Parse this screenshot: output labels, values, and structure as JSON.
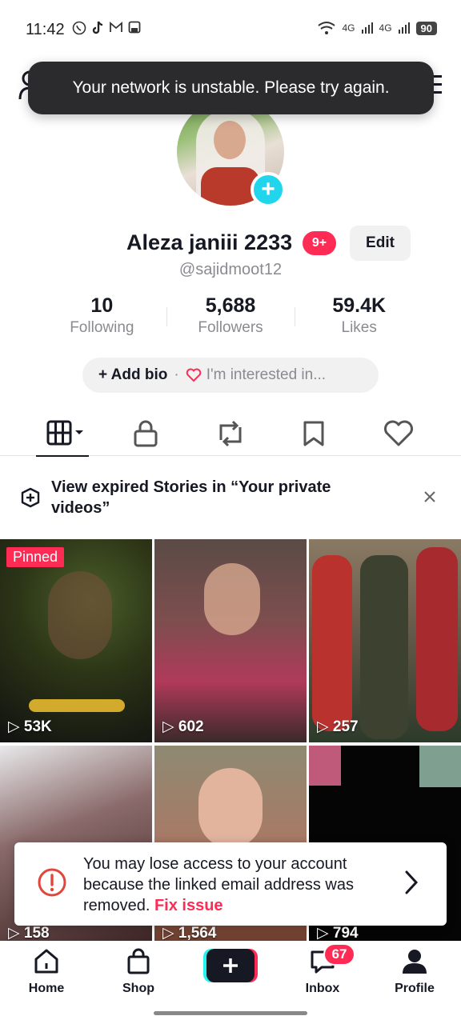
{
  "status_bar": {
    "time": "11:42",
    "network_1": "4G",
    "network_2": "4G",
    "battery": "90"
  },
  "toast": {
    "message": "Your network is unstable. Please try again."
  },
  "profile": {
    "display_name": "Aleza janiii 2233",
    "badge": "9+",
    "edit_label": "Edit",
    "username": "@sajidmoot12"
  },
  "stats": [
    {
      "value": "10",
      "label": "Following"
    },
    {
      "value": "5,688",
      "label": "Followers"
    },
    {
      "value": "59.4K",
      "label": "Likes"
    }
  ],
  "bio": {
    "add_label": "+ Add bio",
    "separator": "·",
    "interest_label": "I'm interested in..."
  },
  "tabs": [
    "grid-icon",
    "lock-icon",
    "repost-icon",
    "bookmark-icon",
    "heart-icon"
  ],
  "stories_banner": {
    "text": "View expired Stories in “Your private videos”"
  },
  "videos": [
    {
      "views": "53K",
      "pinned_label": "Pinned"
    },
    {
      "views": "602"
    },
    {
      "views": "257"
    },
    {
      "views": "158"
    },
    {
      "views": "1,564"
    },
    {
      "views": "794"
    }
  ],
  "warning": {
    "text": "You may lose access to your account because the linked email address was removed.",
    "fix_label": "Fix issue"
  },
  "nav": {
    "home": "Home",
    "shop": "Shop",
    "inbox": "Inbox",
    "inbox_badge": "67",
    "profile": "Profile"
  },
  "colors": {
    "accent": "#fe2c55",
    "cyan": "#20d5ec"
  }
}
